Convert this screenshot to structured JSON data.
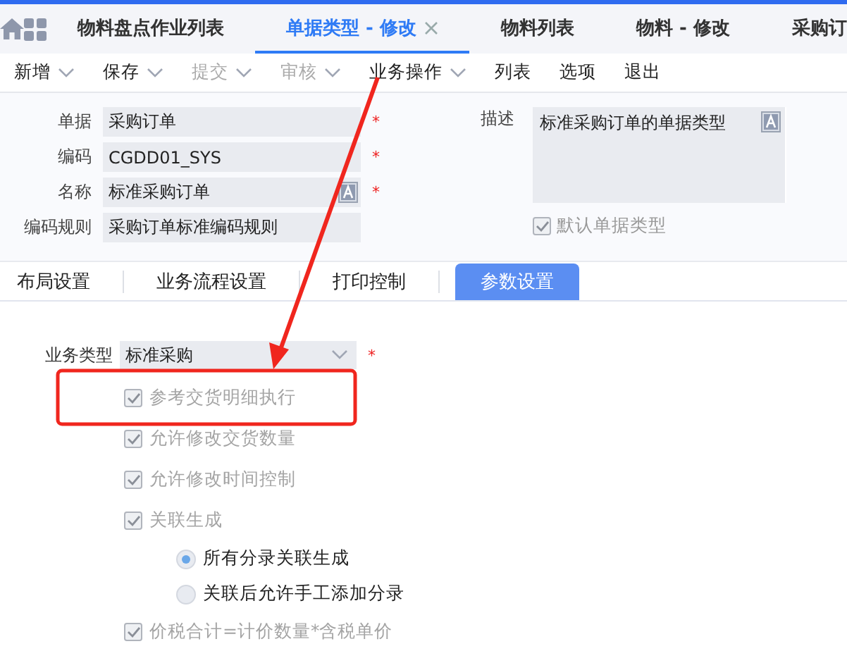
{
  "tabs": [
    {
      "label": "物料盘点作业列表",
      "selected": false,
      "closable": false
    },
    {
      "label": "单据类型 - 修改",
      "selected": true,
      "closable": true
    },
    {
      "label": "物料列表",
      "selected": false,
      "closable": false
    },
    {
      "label": "物料 - 修改",
      "selected": false,
      "closable": false
    },
    {
      "label": "采购订",
      "selected": false,
      "closable": false
    }
  ],
  "toolbar": [
    {
      "label": "新增",
      "dropdown": true,
      "disabled": false
    },
    {
      "label": "保存",
      "dropdown": true,
      "disabled": false
    },
    {
      "label": "提交",
      "dropdown": true,
      "disabled": true
    },
    {
      "label": "审核",
      "dropdown": true,
      "disabled": true
    },
    {
      "label": "业务操作",
      "dropdown": true,
      "disabled": false
    },
    {
      "label": "列表",
      "dropdown": false,
      "disabled": false
    },
    {
      "label": "选项",
      "dropdown": false,
      "disabled": false
    },
    {
      "label": "退出",
      "dropdown": false,
      "disabled": false
    }
  ],
  "form": {
    "fields": [
      {
        "label": "单据",
        "value": "采购订单",
        "required_mark": "*",
        "multilingual": false
      },
      {
        "label": "编码",
        "value": "CGDD01_SYS",
        "required_mark": "*",
        "multilingual": false
      },
      {
        "label": "名称",
        "value": "标准采购订单",
        "required_mark": "*",
        "multilingual": true
      },
      {
        "label": "编码规则",
        "value": "采购订单标准编码规则",
        "multilingual": false
      }
    ],
    "description": {
      "label": "描述",
      "value": "标准采购订单的单据类型",
      "multilingual": true
    },
    "default_type": {
      "label": "默认单据类型",
      "checked": true,
      "disabled": true
    }
  },
  "sub_tabs": [
    {
      "label": "布局设置",
      "selected": false
    },
    {
      "label": "业务流程设置",
      "selected": false
    },
    {
      "label": "打印控制",
      "selected": false
    },
    {
      "label": "参数设置",
      "selected": true
    }
  ],
  "params": {
    "business_type": {
      "label": "业务类型",
      "value": "标准采购",
      "required_mark": "*"
    },
    "options": [
      {
        "kind": "checkbox",
        "label": "参考交货明细执行",
        "checked": true,
        "disabled": true
      },
      {
        "kind": "checkbox",
        "label": "允许修改交货数量",
        "checked": true,
        "disabled": true
      },
      {
        "kind": "checkbox",
        "label": "允许修改时间控制",
        "checked": true,
        "disabled": true
      },
      {
        "kind": "checkbox",
        "label": "关联生成",
        "checked": true,
        "disabled": true
      },
      {
        "kind": "radio",
        "label": "所有分录关联生成",
        "selected": true
      },
      {
        "kind": "radio",
        "label": "关联后允许手工添加分录",
        "selected": false
      },
      {
        "kind": "checkbox",
        "label": "价税合计=计价数量*含税单价",
        "checked": true,
        "disabled": true
      }
    ]
  }
}
